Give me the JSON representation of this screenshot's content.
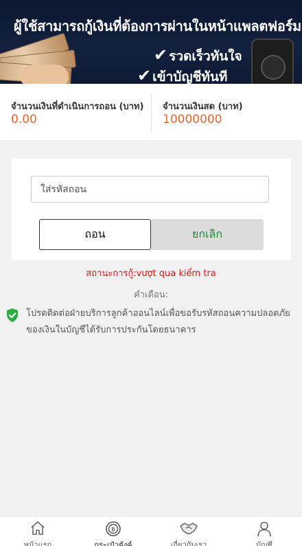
{
  "banner": {
    "headline": "ผู้ใช้สามารถกู้เงินที่ต้องการผ่านในหน้าแพลตฟอร์ม",
    "feature_1": "รวดเร็วทันใจ",
    "feature_2": "เข้าบัญชีทันที",
    "check_icon": "check-mark-icon"
  },
  "balance": {
    "withdrawing_label": "จำนวนเงินที่ดำเนินการถอน (บาท)",
    "withdrawing_value": "0.00",
    "cash_label": "จำนวนเงินสด (บาท)",
    "cash_value": "10000000"
  },
  "form": {
    "code_placeholder": "ใส่รหัสถอน",
    "code_value": "",
    "withdraw_label": "ถอน",
    "cancel_label": "ยกเลิก"
  },
  "status_text": "สถานะการกู้:vượt qua kiểm tra",
  "warning": {
    "title": "คำเตือน:",
    "text": "โปรดติดต่อฝ่ายบริการลูกค้าออนไลน์เพื่อขอรับรหัสถอนความปลอดภัยของเงินในบัญชีได้รับการประกันโดยธนาคาร",
    "icon": "shield-check-icon"
  },
  "nav": [
    {
      "label": "หน้าแรก",
      "icon": "home-icon"
    },
    {
      "label": "กระเป๋าตังค์",
      "icon": "wallet-coin-icon"
    },
    {
      "label": "เกี่ยวกับเรา",
      "icon": "handshake-icon"
    },
    {
      "label": "บัญชี",
      "icon": "user-icon"
    }
  ],
  "colors": {
    "accent_orange": "#e8652a",
    "status_red": "#e01313",
    "cancel_green": "#1a8b2f",
    "shield_green": "#27ae3c",
    "banner_navy": "#13213f"
  }
}
